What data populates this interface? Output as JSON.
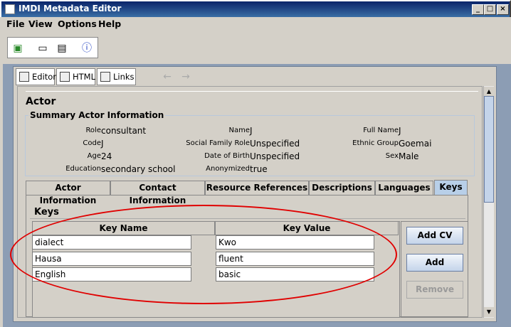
{
  "window": {
    "title": "IMDI Metadata Editor"
  },
  "menu": [
    "File",
    "View",
    "Options",
    "Help"
  ],
  "toolbar": {
    "icons": [
      "new-doc-icon",
      "open-folder-icon",
      "save-icon",
      "info-icon"
    ]
  },
  "viewtabs": [
    {
      "label": "Editor"
    },
    {
      "label": "HTML"
    },
    {
      "label": "Links"
    }
  ],
  "section": {
    "title": "Actor"
  },
  "summary": {
    "title": "Summary Actor Information",
    "fields": [
      {
        "label": "Role",
        "value": "consultant"
      },
      {
        "label": "Name",
        "value": "J"
      },
      {
        "label": "Full Name",
        "value": "J"
      },
      {
        "label": "Code",
        "value": "J"
      },
      {
        "label": "Social Family Role",
        "value": "Unspecified"
      },
      {
        "label": "Ethnic Group",
        "value": "Goemai"
      },
      {
        "label": "Age",
        "value": "24"
      },
      {
        "label": "Date of Birth",
        "value": "Unspecified"
      },
      {
        "label": "Sex",
        "value": "Male"
      },
      {
        "label": "Education",
        "value": "secondary school"
      },
      {
        "label": "Anonymized",
        "value": "true"
      }
    ]
  },
  "tabs": [
    "Actor Information",
    "Contact Information",
    "Resource References",
    "Descriptions",
    "Languages",
    "Keys"
  ],
  "keys": {
    "heading": "Keys",
    "columns": [
      "Key Name",
      "Key Value"
    ],
    "rows": [
      [
        "dialect",
        "Kwo"
      ],
      [
        "Hausa",
        "fluent"
      ],
      [
        "English",
        "basic"
      ]
    ],
    "buttons": [
      "Add CV",
      "Add",
      "Remove"
    ]
  },
  "colors": {
    "annotation": "#e00000",
    "activeTab": "#b8cfe8"
  }
}
